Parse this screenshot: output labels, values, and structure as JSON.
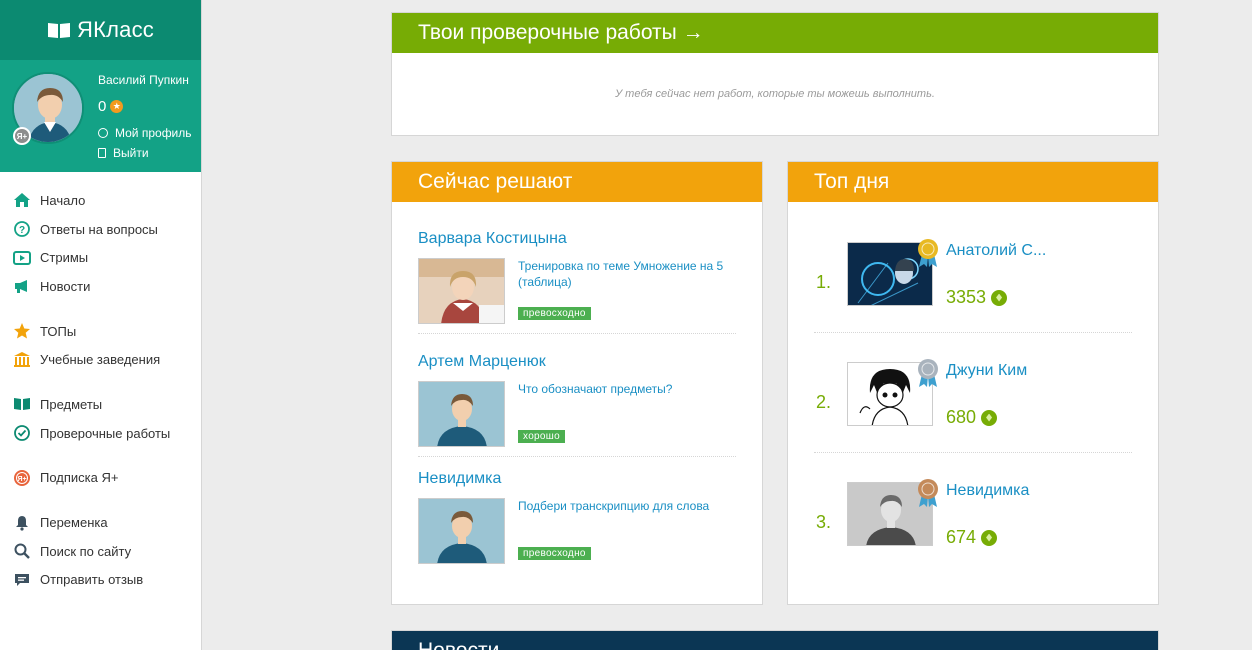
{
  "sidebar": {
    "logo_text": "ЯКласс",
    "user": {
      "name": "Василий Пупкин",
      "points": "0",
      "badge": "Я+",
      "profile_link": "Мой профиль",
      "logout_link": "Выйти"
    },
    "nav": [
      {
        "label": "Начало",
        "icon": "home-icon"
      },
      {
        "label": "Ответы на вопросы",
        "icon": "question-icon"
      },
      {
        "label": "Стримы",
        "icon": "play-icon"
      },
      {
        "label": "Новости",
        "icon": "megaphone-icon"
      },
      {
        "label": "ТОПы",
        "icon": "star-icon"
      },
      {
        "label": "Учебные заведения",
        "icon": "building-icon"
      },
      {
        "label": "Предметы",
        "icon": "book-icon"
      },
      {
        "label": "Проверочные работы",
        "icon": "check-circle-icon"
      },
      {
        "label": "Подписка Я+",
        "icon": "ya-plus-icon"
      },
      {
        "label": "Переменка",
        "icon": "bell-icon"
      },
      {
        "label": "Поиск по сайту",
        "icon": "search-icon"
      },
      {
        "label": "Отправить отзыв",
        "icon": "feedback-icon"
      }
    ]
  },
  "tests_panel": {
    "title": "Твои проверочные работы →",
    "empty_message": "У тебя сейчас нет работ, которые ты можешь выполнить."
  },
  "solving_panel": {
    "title": "Сейчас решают",
    "entries": [
      {
        "user": "Варвара Костицына",
        "task": "Тренировка по теме Умножение на 5 (таблица)",
        "grade": "превосходно"
      },
      {
        "user": "Артем Марценюк",
        "task": "Что обозначают предметы?",
        "grade": "хорошо"
      },
      {
        "user": "Невидимка",
        "task": "Подбери транскрипцию для слова",
        "grade": "превосходно"
      }
    ]
  },
  "top_panel": {
    "title": "Топ дня",
    "entries": [
      {
        "rank": "1.",
        "name": "Анатолий С...",
        "score": "3353",
        "medal_color": "#e8b923"
      },
      {
        "rank": "2.",
        "name": "Джуни Ким",
        "score": "680",
        "medal_color": "#a9b3bd"
      },
      {
        "rank": "3.",
        "name": "Невидимка",
        "score": "674",
        "medal_color": "#c48a5a"
      }
    ]
  },
  "news_panel": {
    "title": "Новости"
  },
  "colors": {
    "brand_teal": "#13a286",
    "header_green": "#77ac05",
    "header_orange": "#f2a30c",
    "header_navy": "#0b3654",
    "link_blue": "#1a8fc4"
  }
}
